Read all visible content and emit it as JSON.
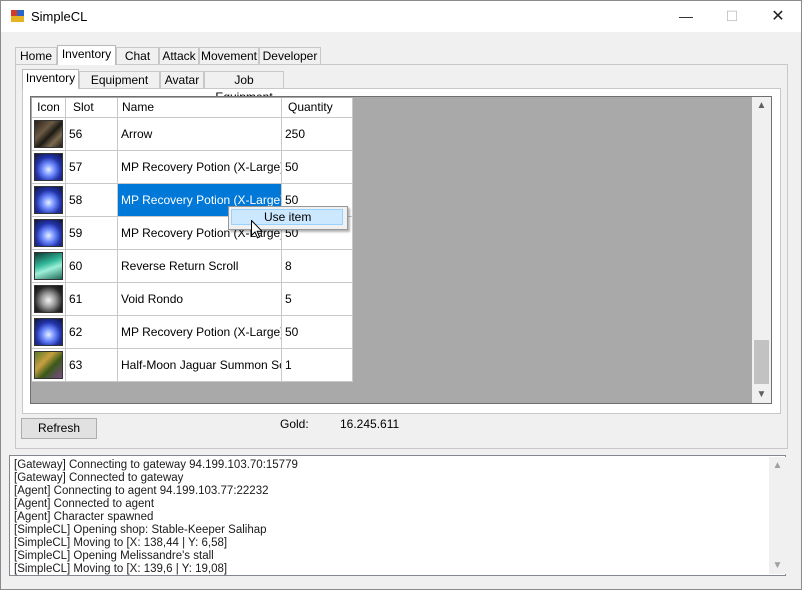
{
  "window": {
    "title": "SimpleCL",
    "minimize": "—",
    "maximize": "☐",
    "close": "✕"
  },
  "main_tabs": [
    "Home",
    "Inventory",
    "Chat",
    "Attack",
    "Movement",
    "Developer"
  ],
  "sub_tabs": [
    "Inventory",
    "Equipment",
    "Avatar",
    "Job Equipment"
  ],
  "table": {
    "columns": [
      "Icon",
      "Slot",
      "Name",
      "Quantity"
    ],
    "rows": [
      {
        "icon": "arrow-item-icon",
        "slot": "56",
        "name": "Arrow",
        "qty": "250"
      },
      {
        "icon": "mp-potion-icon",
        "slot": "57",
        "name": "MP Recovery Potion (X-Large)",
        "qty": "50"
      },
      {
        "icon": "mp-potion-icon",
        "slot": "58",
        "name": "MP Recovery Potion (X-Large)",
        "qty": "50"
      },
      {
        "icon": "mp-potion-icon",
        "slot": "59",
        "name": "MP Recovery Potion (X-Large)",
        "qty": "50"
      },
      {
        "icon": "return-scroll-icon",
        "slot": "60",
        "name": "Reverse Return Scroll",
        "qty": "8"
      },
      {
        "icon": "void-rondo-icon",
        "slot": "61",
        "name": "Void Rondo",
        "qty": "5"
      },
      {
        "icon": "mp-potion-icon",
        "slot": "62",
        "name": "MP Recovery Potion (X-Large)",
        "qty": "50"
      },
      {
        "icon": "jaguar-scroll-icon",
        "slot": "63",
        "name": "Half-Moon Jaguar Summon Scroll",
        "qty": "1"
      }
    ],
    "selected_row": 2
  },
  "context_menu": {
    "use_item": "Use item"
  },
  "refresh_label": "Refresh",
  "gold": {
    "label": "Gold:",
    "value": "16.245.611"
  },
  "log": [
    "[Gateway] Connecting to gateway 94.199.103.70:15779",
    "[Gateway] Connected to gateway",
    "[Agent] Connecting to agent 94.199.103.77:22232",
    "[Agent] Connected to agent",
    "[Agent] Character spawned",
    "[SimpleCL] Opening shop: Stable-Keeper Salihap",
    "[SimpleCL] Moving to [X: 138,44 | Y: 6,58]",
    "[SimpleCL] Opening Melissandre's stall",
    "[SimpleCL] Moving to [X: 139,6 | Y: 19,08]"
  ],
  "colors": {
    "selection": "#0078d7",
    "grid_background": "#a9a9a9",
    "menu_highlight": "#cce8ff"
  }
}
